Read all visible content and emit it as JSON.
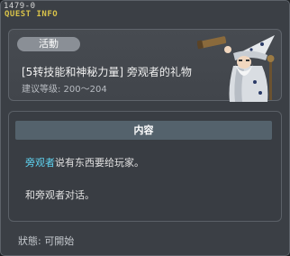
{
  "window": {
    "quest_id": "1479-0",
    "title": "QUEST INFO"
  },
  "header": {
    "category": "活動",
    "quest_name": "[5转技能和神秘力量] 旁观者的礼物",
    "level_requirement": "建议等级: 200～204",
    "npc_icon": "robed-wizard-npc-with-telescope"
  },
  "content": {
    "section_title": "内容",
    "npc_name": "旁观者",
    "line1_rest": "说有东西要给玩家。",
    "line2": "和旁观者对话。"
  },
  "status": {
    "text": "狀態: 可開始"
  },
  "colors": {
    "title_yellow": "#d9c34a",
    "npc_link": "#5fd3f0",
    "section_header": "#54626c"
  }
}
